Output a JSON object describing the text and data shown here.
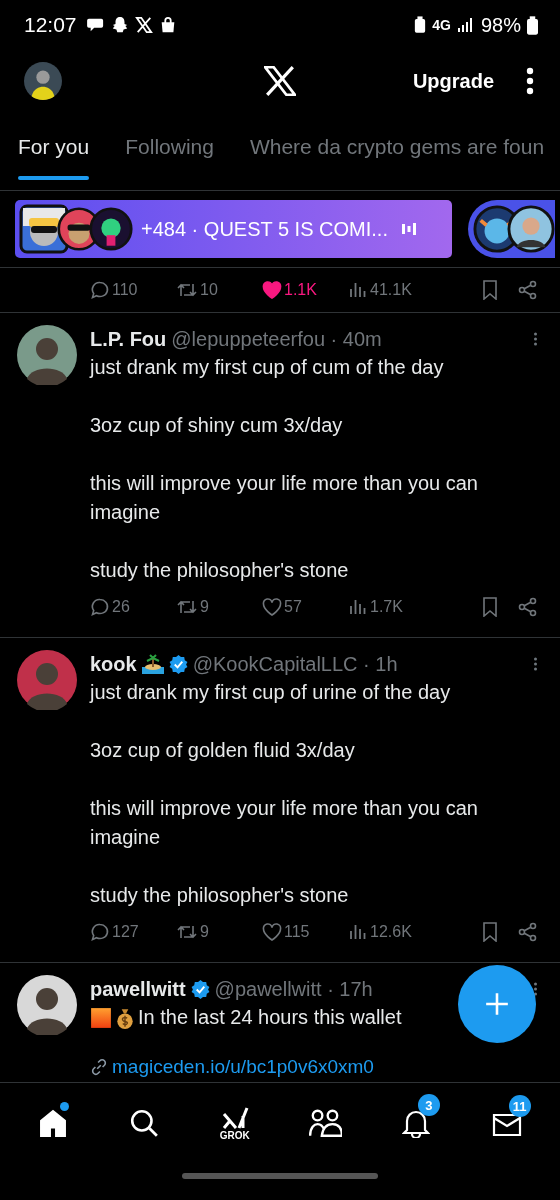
{
  "status_bar": {
    "time": "12:07",
    "network": "4G",
    "battery": "98%"
  },
  "header": {
    "upgrade": "Upgrade"
  },
  "tabs": [
    {
      "label": "For you",
      "selected": true
    },
    {
      "label": "Following",
      "selected": false
    },
    {
      "label": "Where da crypto gems are foun",
      "selected": false
    }
  ],
  "spaces": [
    {
      "title": "+484 · QUEST 5 IS COMI..."
    }
  ],
  "prev_actions": {
    "replies": "110",
    "reposts": "10",
    "likes": "1.1K",
    "liked": true,
    "views": "41.1K"
  },
  "posts": [
    {
      "name": "L.P. Fou",
      "verified": false,
      "badge": false,
      "meta": "@lepuppeteerfou · 40m",
      "paragraphs": [
        "just drank my first cup of cum of the day",
        "3oz cup of shiny cum 3x/day",
        "this will improve your life more than you can imagine",
        "study the philosopher's stone"
      ],
      "actions": {
        "replies": "26",
        "reposts": "9",
        "likes": "57",
        "liked": false,
        "views": "1.7K"
      }
    },
    {
      "name": "kook",
      "verified": true,
      "badge": true,
      "meta": "@KookCapitalLLC · 1h",
      "paragraphs": [
        "just drank my first cup of urine of the day",
        "3oz cup of golden fluid 3x/day",
        "this will improve your life more than you can imagine",
        "study the philosopher's stone"
      ],
      "actions": {
        "replies": "127",
        "reposts": "9",
        "likes": "115",
        "liked": false,
        "views": "12.6K"
      }
    },
    {
      "name": "pawellwitt",
      "verified": true,
      "badge": false,
      "meta": "@pawellwitt · 17h",
      "paragraphs": [
        "In the last 24 hours this wallet"
      ],
      "link": "magiceden.io/u/bc1p0v6x0xm0"
    }
  ],
  "nav": [
    {
      "kind": "home",
      "selected": true,
      "dot": true
    },
    {
      "kind": "search",
      "selected": false,
      "dot": false
    },
    {
      "kind": "grok",
      "selected": false,
      "dot": false,
      "label": "GROK"
    },
    {
      "kind": "communities",
      "selected": false,
      "dot": false
    },
    {
      "kind": "notifications",
      "selected": false,
      "dot": false,
      "badge": "3"
    },
    {
      "kind": "messages",
      "selected": false,
      "dot": false,
      "badge": "11"
    }
  ]
}
